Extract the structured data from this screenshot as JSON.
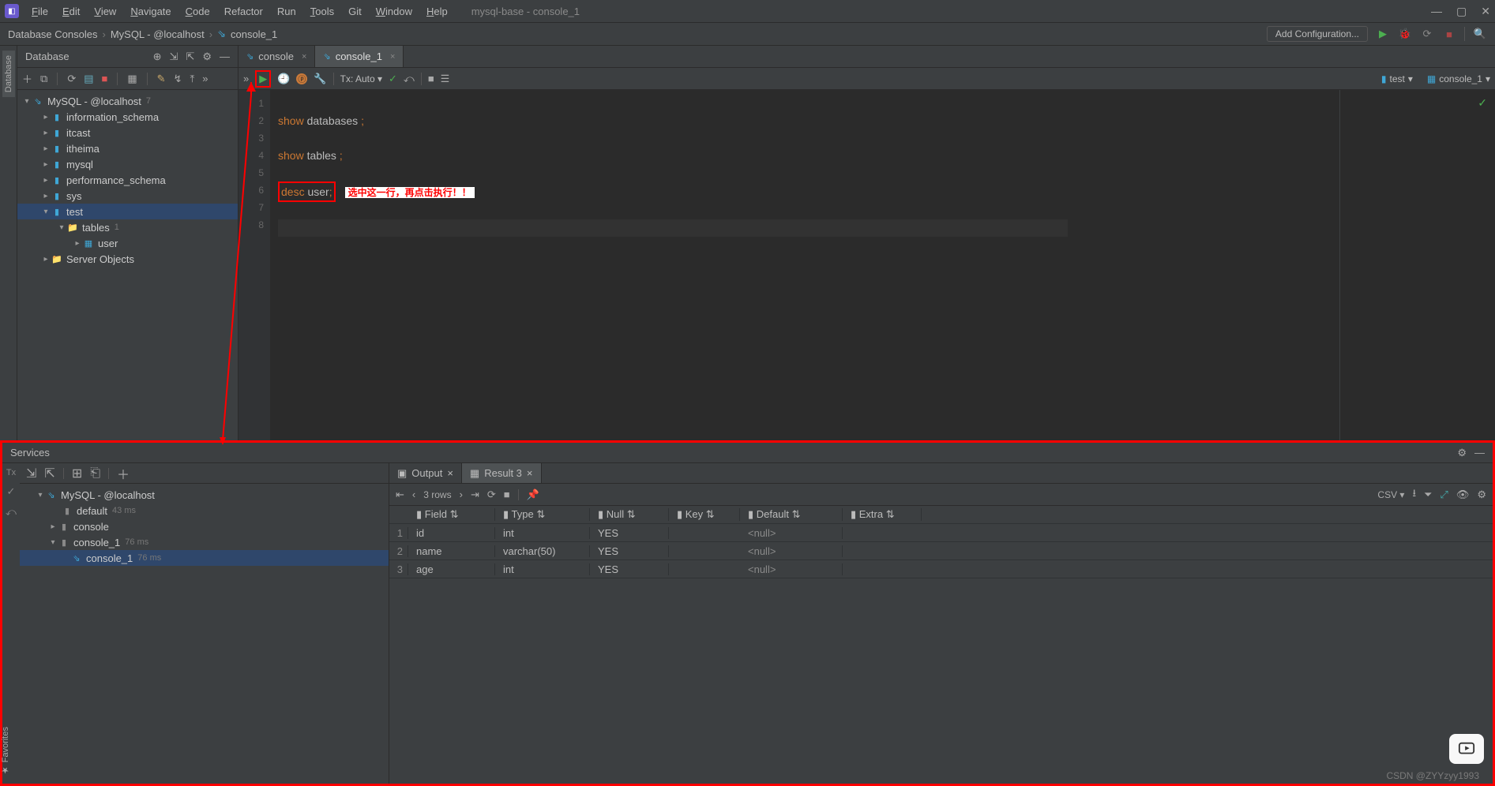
{
  "menu": {
    "file": "File",
    "edit": "Edit",
    "view": "View",
    "nav": "Navigate",
    "code": "Code",
    "refactor": "Refactor",
    "run": "Run",
    "tools": "Tools",
    "git": "Git",
    "window": "Window",
    "help": "Help"
  },
  "window_title": "mysql-base - console_1",
  "breadcrumbs": [
    "Database Consoles",
    "MySQL - @localhost",
    "console_1"
  ],
  "addConfig": "Add Configuration...",
  "dbPanel": {
    "title": "Database",
    "root": {
      "label": "MySQL - @localhost",
      "count": "7"
    },
    "schemas": [
      "information_schema",
      "itcast",
      "itheima",
      "mysql",
      "performance_schema",
      "sys"
    ],
    "testSchema": {
      "label": "test",
      "tablesLabel": "tables",
      "tablesCount": "1",
      "tables": [
        "user"
      ]
    },
    "serverObjects": "Server Objects"
  },
  "tabs": [
    {
      "label": "console",
      "active": false
    },
    {
      "label": "console_1",
      "active": true
    }
  ],
  "txAuto": "Tx: Auto",
  "statusRight": [
    {
      "icon": "db",
      "label": "test"
    },
    {
      "icon": "console",
      "label": "console_1"
    }
  ],
  "editor": {
    "lines": [
      "1",
      "2",
      "3",
      "4",
      "5",
      "6",
      "7",
      "8"
    ],
    "l1a": "show",
    "l1b": " databases ",
    "l1c": ";",
    "l3a": "show",
    "l3b": " tables ",
    "l3c": ";",
    "l5a": "desc",
    "l5b": " user",
    "l5c": ";",
    "annotation": "选中这一行，再点击执行！！"
  },
  "services": {
    "title": "Services",
    "txlabel": "Tx",
    "tree": {
      "root": "MySQL - @localhost",
      "defaultLabel": "default",
      "defaultTime": "43 ms",
      "console": "console",
      "console1": "console_1",
      "console1Time": "76 ms",
      "sub": "console_1",
      "subTime": "76 ms"
    },
    "outputTab": "Output",
    "resultTab": "Result 3",
    "rowCount": "3 rows",
    "csv": "CSV",
    "columns": [
      "Field",
      "Type",
      "Null",
      "Key",
      "Default",
      "Extra"
    ],
    "rows": [
      {
        "n": "1",
        "Field": "id",
        "Type": "int",
        "Null": "YES",
        "Key": "",
        "Default": "<null>",
        "Extra": ""
      },
      {
        "n": "2",
        "Field": "name",
        "Type": "varchar(50)",
        "Null": "YES",
        "Key": "",
        "Default": "<null>",
        "Extra": ""
      },
      {
        "n": "3",
        "Field": "age",
        "Type": "int",
        "Null": "YES",
        "Key": "",
        "Default": "<null>",
        "Extra": ""
      }
    ]
  },
  "leftTabs": {
    "database": "Database"
  },
  "favorites": "Favorites",
  "watermark": "CSDN @ZYYzyy1993"
}
